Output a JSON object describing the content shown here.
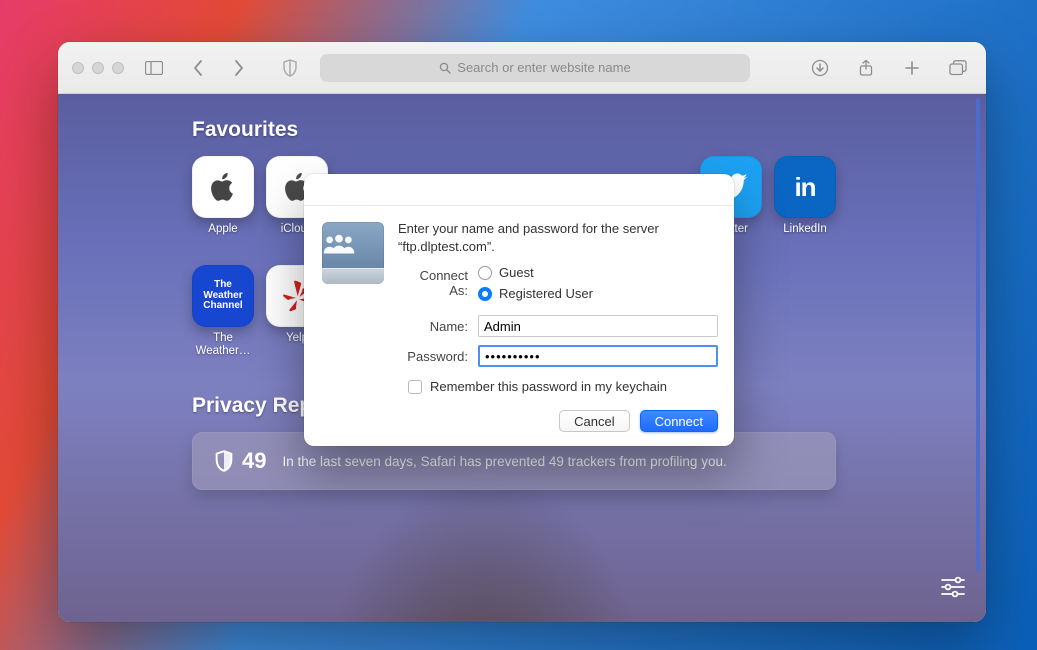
{
  "toolbar": {
    "search_placeholder": "Search or enter website name"
  },
  "favourites": {
    "title": "Favourites",
    "row1": [
      {
        "label": "Apple"
      },
      {
        "label": "iCloud"
      },
      {
        "label": "Twitter"
      },
      {
        "label": "LinkedIn"
      }
    ],
    "row2": [
      {
        "label": "The Weather…"
      },
      {
        "label": "Yelp"
      }
    ]
  },
  "privacy": {
    "title": "Privacy Report",
    "count": "49",
    "message": "In the last seven days, Safari has prevented 49 trackers from profiling you."
  },
  "auth": {
    "prompt": "Enter your name and password for the server “ftp.dlptest.com”.",
    "connect_as_label": "Connect As:",
    "guest_label": "Guest",
    "registered_label": "Registered User",
    "name_label": "Name:",
    "name_value": "Admin",
    "password_label": "Password:",
    "password_value": "••••••••••",
    "remember_label": "Remember this password in my keychain",
    "cancel": "Cancel",
    "connect": "Connect"
  }
}
